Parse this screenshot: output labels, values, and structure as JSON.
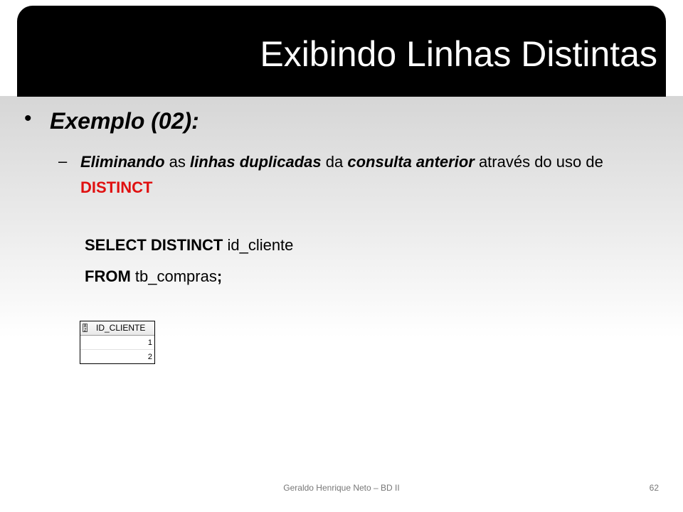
{
  "slide": {
    "title": "Exibindo Linhas Distintas",
    "bullet": "Exemplo (02):",
    "sub": {
      "dash": "–",
      "p1": "Eliminando",
      "p2": " as ",
      "p3": "linhas duplicadas",
      "p4": " da ",
      "p5": "consulta anterior",
      "p6": " através do uso de ",
      "p7": "DISTINCT"
    },
    "sql": {
      "line1_kw": "SELECT DISTINCT",
      "line1_rest": " id_cliente",
      "line2_kw": "FROM",
      "line2_rest": " tb_compras",
      "line2_end": ";"
    },
    "result": {
      "column": "ID_CLIENTE",
      "rows": [
        "1",
        "2"
      ]
    },
    "footer": {
      "text": "Geraldo Henrique Neto – BD II",
      "page": "62"
    },
    "colors": {
      "title_bg": "#000000",
      "highlight": "#e01010"
    }
  }
}
